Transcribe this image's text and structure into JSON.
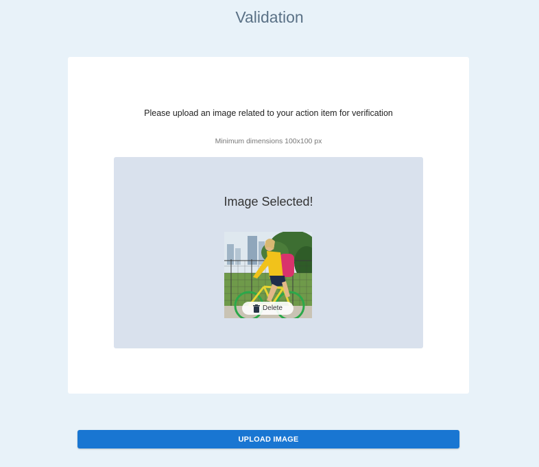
{
  "page": {
    "title": "Validation"
  },
  "card": {
    "instruction": "Please upload an image related to your action item for verification",
    "hint": "Minimum dimensions 100x100 px"
  },
  "dropzone": {
    "status": "Image Selected!",
    "delete_label": "Delete",
    "delete_icon": "trash-icon"
  },
  "actions": {
    "upload_label": "UPLOAD IMAGE"
  },
  "colors": {
    "background": "#e8f2f9",
    "dropzone": "#d9e1ed",
    "primary_button": "#1976d2",
    "title": "#5a7186"
  }
}
